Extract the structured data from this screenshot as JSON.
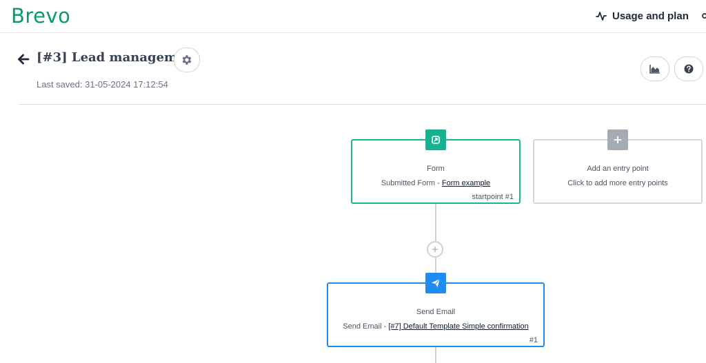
{
  "brand": {
    "logo_text": "Brevo",
    "color": "#0b996e"
  },
  "topbar": {
    "usage_label": "Usage and plan",
    "usage_icon": "activity-icon"
  },
  "header": {
    "title": "[#3] Lead management",
    "last_saved": "Last saved: 31-05-2024 17:12:54",
    "icons": [
      "arrow-left-icon",
      "gear-icon",
      "area-chart-icon",
      "question-icon"
    ]
  },
  "workflow": {
    "form_node": {
      "title": "Form",
      "subtitle_prefix": "Submitted Form - ",
      "subtitle_link": "Form example",
      "footer": "startpoint #1",
      "color": "#1db693"
    },
    "entry_node": {
      "title": "Add an entry point",
      "subtitle": "Click to add more entry points",
      "color": "#a4abb3"
    },
    "email_node": {
      "title": "Send Email",
      "subtitle_prefix": "Send Email - ",
      "subtitle_link": "[#7] Default Template Simple confirmation",
      "footer": "#1",
      "color": "#1e8cf0"
    }
  }
}
